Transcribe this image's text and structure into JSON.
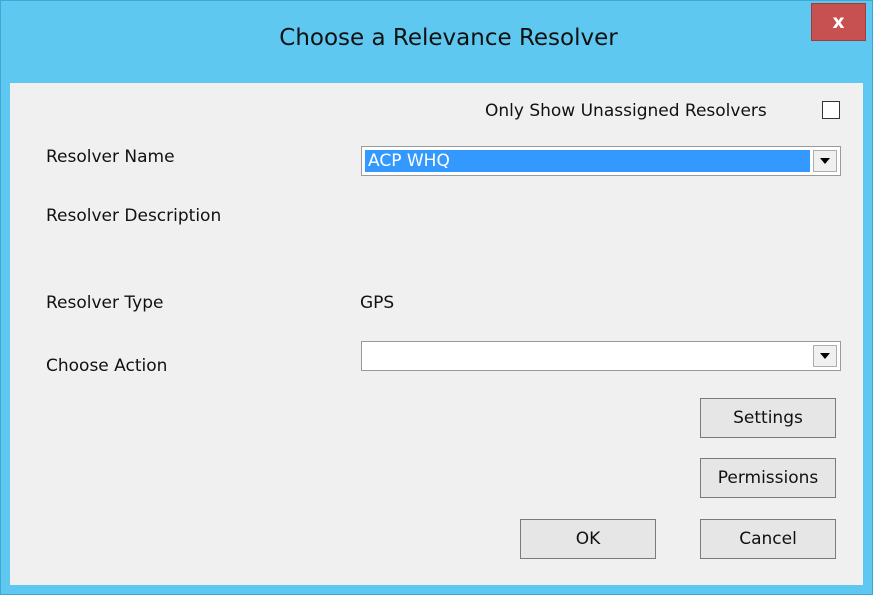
{
  "window": {
    "title": "Choose a Relevance Resolver",
    "close_label": "x"
  },
  "filter": {
    "only_unassigned_label": "Only Show Unassigned Resolvers",
    "only_unassigned_checked": false
  },
  "fields": {
    "resolver_name_label": "Resolver Name",
    "resolver_name_value": "ACP WHQ",
    "resolver_description_label": "Resolver Description",
    "resolver_type_label": "Resolver Type",
    "resolver_type_value": "GPS",
    "choose_action_label": "Choose Action",
    "choose_action_value": ""
  },
  "buttons": {
    "settings": "Settings",
    "permissions": "Permissions",
    "ok": "OK",
    "cancel": "Cancel"
  },
  "colors": {
    "title_bar": "#5ec8f0",
    "close_button": "#c75050",
    "selection": "#3399ff",
    "client_background": "#f0f0f0"
  }
}
